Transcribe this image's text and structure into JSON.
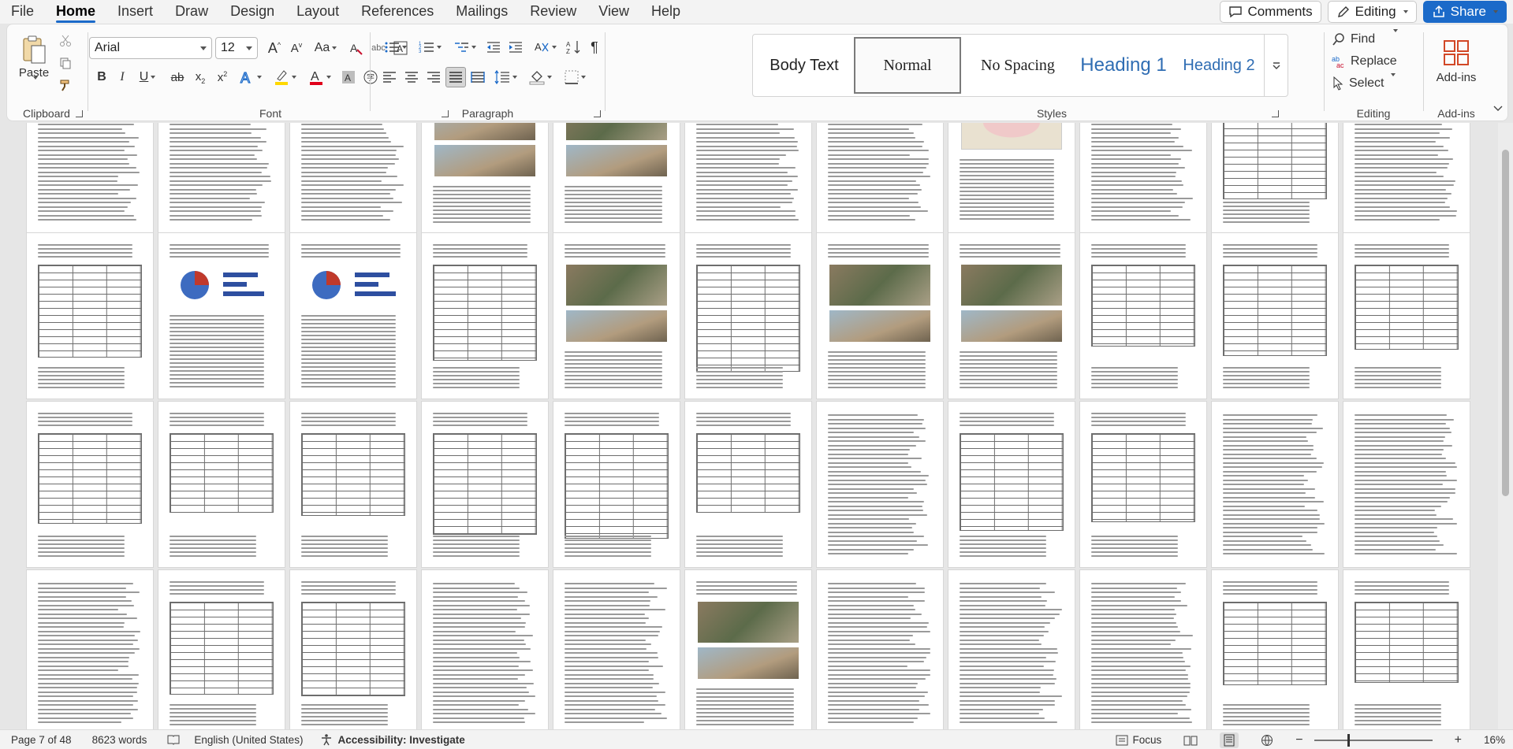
{
  "menu": {
    "items": [
      "File",
      "Home",
      "Insert",
      "Draw",
      "Design",
      "Layout",
      "References",
      "Mailings",
      "Review",
      "View",
      "Help"
    ],
    "active": "Home"
  },
  "topright": {
    "comments": "Comments",
    "editing": "Editing",
    "share": "Share"
  },
  "ribbon": {
    "clipboard": {
      "label": "Clipboard",
      "paste": "Paste"
    },
    "font": {
      "label": "Font",
      "font_name": "Arial",
      "font_size": "12"
    },
    "paragraph": {
      "label": "Paragraph"
    },
    "styles": {
      "label": "Styles",
      "tiles": [
        "Body Text",
        "Normal",
        "No Spacing",
        "Heading 1",
        "Heading 2"
      ]
    },
    "editing": {
      "label": "Editing",
      "find": "Find",
      "replace": "Replace",
      "select": "Select"
    },
    "addins": {
      "label": "Add-ins",
      "button": "Add-ins"
    }
  },
  "status": {
    "page": "Page 7 of 48",
    "words": "8623 words",
    "language": "English (United States)",
    "accessibility": "Accessibility: Investigate",
    "focus": "Focus",
    "zoom": "16%"
  },
  "colors": {
    "accent": "#1b6ac9",
    "highlight": "#ffd800",
    "font_color": "#e0001b"
  }
}
